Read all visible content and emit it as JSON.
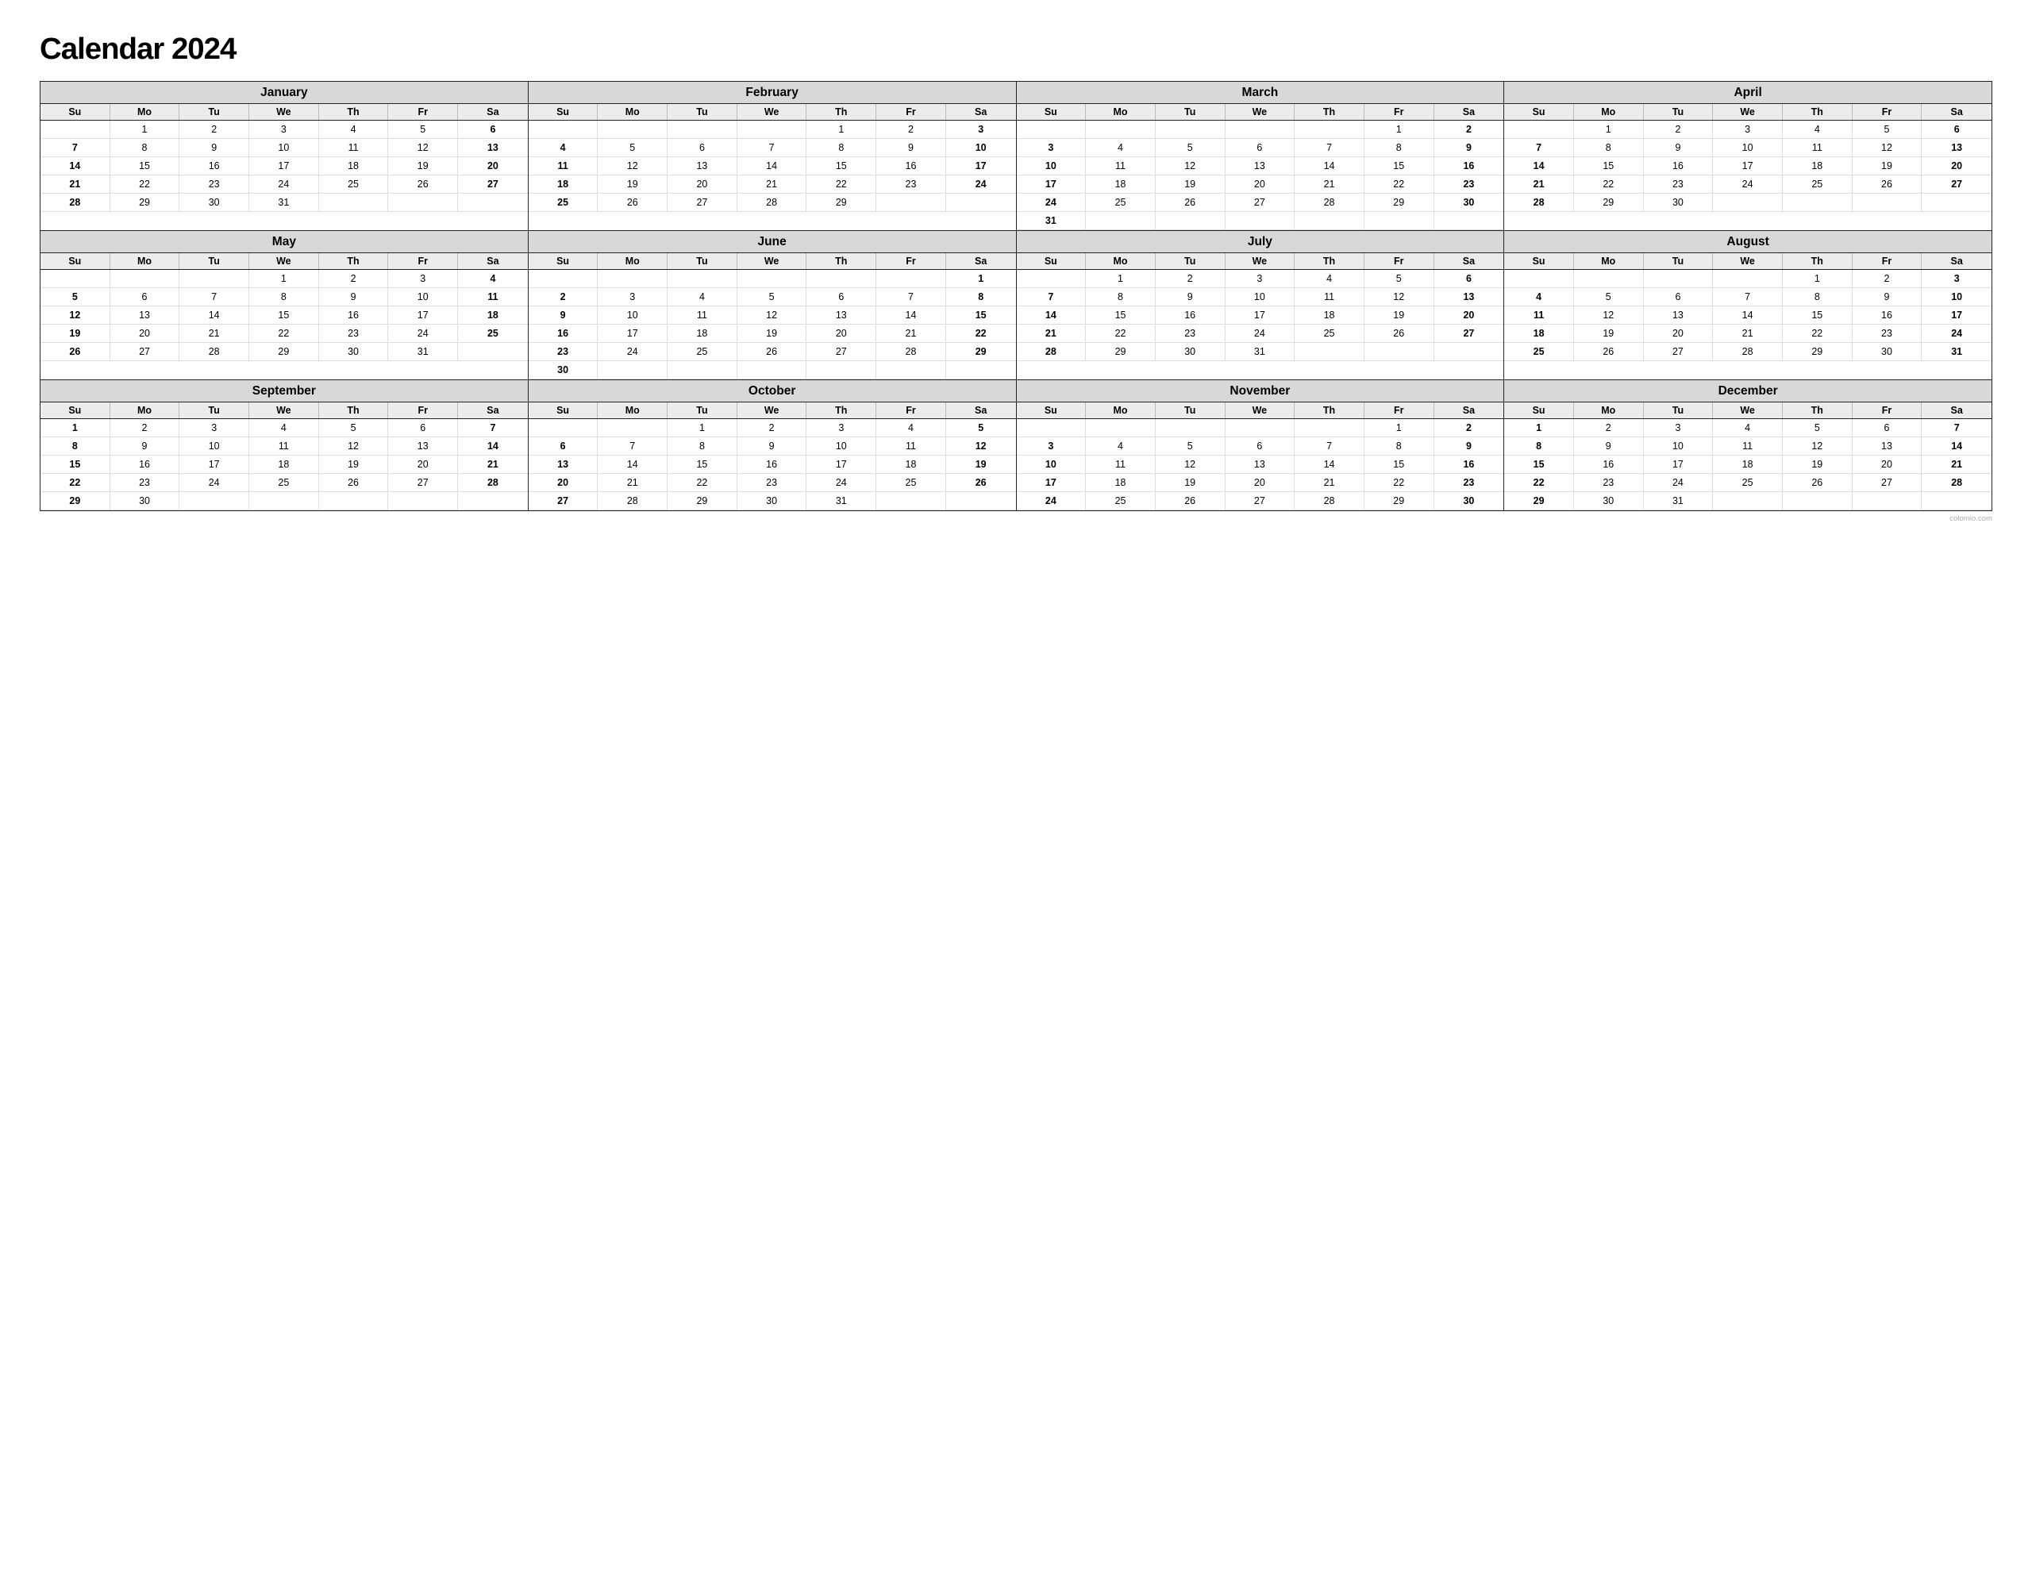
{
  "title": "Calendar 2024",
  "months": [
    {
      "name": "January",
      "startDay": 1,
      "days": 31,
      "weeks": [
        [
          "",
          "1",
          "2",
          "3",
          "4",
          "5",
          "6"
        ],
        [
          "7",
          "8",
          "9",
          "10",
          "11",
          "12",
          "13"
        ],
        [
          "14",
          "15",
          "16",
          "17",
          "18",
          "19",
          "20"
        ],
        [
          "21",
          "22",
          "23",
          "24",
          "25",
          "26",
          "27"
        ],
        [
          "28",
          "29",
          "30",
          "31",
          "",
          "",
          ""
        ]
      ]
    },
    {
      "name": "February",
      "startDay": 4,
      "days": 29,
      "weeks": [
        [
          "",
          "",
          "",
          "",
          "1",
          "2",
          "3"
        ],
        [
          "4",
          "5",
          "6",
          "7",
          "8",
          "9",
          "10"
        ],
        [
          "11",
          "12",
          "13",
          "14",
          "15",
          "16",
          "17"
        ],
        [
          "18",
          "19",
          "20",
          "21",
          "22",
          "23",
          "24"
        ],
        [
          "25",
          "26",
          "27",
          "28",
          "29",
          "",
          ""
        ]
      ]
    },
    {
      "name": "March",
      "startDay": 5,
      "days": 31,
      "weeks": [
        [
          "",
          "",
          "",
          "",
          "",
          "1",
          "2"
        ],
        [
          "3",
          "4",
          "5",
          "6",
          "7",
          "8",
          "9"
        ],
        [
          "10",
          "11",
          "12",
          "13",
          "14",
          "15",
          "16"
        ],
        [
          "17",
          "18",
          "19",
          "20",
          "21",
          "22",
          "23"
        ],
        [
          "24",
          "25",
          "26",
          "27",
          "28",
          "29",
          "30"
        ],
        [
          "31",
          "",
          "",
          "",
          "",
          "",
          ""
        ]
      ]
    },
    {
      "name": "April",
      "startDay": 1,
      "days": 30,
      "weeks": [
        [
          "",
          "1",
          "2",
          "3",
          "4",
          "5",
          "6"
        ],
        [
          "7",
          "8",
          "9",
          "10",
          "11",
          "12",
          "13"
        ],
        [
          "14",
          "15",
          "16",
          "17",
          "18",
          "19",
          "20"
        ],
        [
          "21",
          "22",
          "23",
          "24",
          "25",
          "26",
          "27"
        ],
        [
          "28",
          "29",
          "30",
          "",
          "",
          "",
          ""
        ]
      ]
    },
    {
      "name": "May",
      "startDay": 3,
      "days": 31,
      "weeks": [
        [
          "",
          "",
          "",
          "1",
          "2",
          "3",
          "4"
        ],
        [
          "5",
          "6",
          "7",
          "8",
          "9",
          "10",
          "11"
        ],
        [
          "12",
          "13",
          "14",
          "15",
          "16",
          "17",
          "18"
        ],
        [
          "19",
          "20",
          "21",
          "22",
          "23",
          "24",
          "25"
        ],
        [
          "26",
          "27",
          "28",
          "29",
          "30",
          "31",
          ""
        ]
      ]
    },
    {
      "name": "June",
      "startDay": 6,
      "days": 30,
      "weeks": [
        [
          "",
          "",
          "",
          "",
          "",
          "",
          "1"
        ],
        [
          "2",
          "3",
          "4",
          "5",
          "6",
          "7",
          "8"
        ],
        [
          "9",
          "10",
          "11",
          "12",
          "13",
          "14",
          "15"
        ],
        [
          "16",
          "17",
          "18",
          "19",
          "20",
          "21",
          "22"
        ],
        [
          "23",
          "24",
          "25",
          "26",
          "27",
          "28",
          "29"
        ],
        [
          "30",
          "",
          "",
          "",
          "",
          "",
          ""
        ]
      ]
    },
    {
      "name": "July",
      "startDay": 1,
      "days": 31,
      "weeks": [
        [
          "",
          "1",
          "2",
          "3",
          "4",
          "5",
          "6"
        ],
        [
          "7",
          "8",
          "9",
          "10",
          "11",
          "12",
          "13"
        ],
        [
          "14",
          "15",
          "16",
          "17",
          "18",
          "19",
          "20"
        ],
        [
          "21",
          "22",
          "23",
          "24",
          "25",
          "26",
          "27"
        ],
        [
          "28",
          "29",
          "30",
          "31",
          "",
          "",
          ""
        ]
      ]
    },
    {
      "name": "August",
      "startDay": 4,
      "days": 31,
      "weeks": [
        [
          "",
          "",
          "",
          "",
          "1",
          "2",
          "3"
        ],
        [
          "4",
          "5",
          "6",
          "7",
          "8",
          "9",
          "10"
        ],
        [
          "11",
          "12",
          "13",
          "14",
          "15",
          "16",
          "17"
        ],
        [
          "18",
          "19",
          "20",
          "21",
          "22",
          "23",
          "24"
        ],
        [
          "25",
          "26",
          "27",
          "28",
          "29",
          "30",
          "31"
        ]
      ]
    },
    {
      "name": "September",
      "startDay": 0,
      "days": 30,
      "weeks": [
        [
          "1",
          "2",
          "3",
          "4",
          "5",
          "6",
          "7"
        ],
        [
          "8",
          "9",
          "10",
          "11",
          "12",
          "13",
          "14"
        ],
        [
          "15",
          "16",
          "17",
          "18",
          "19",
          "20",
          "21"
        ],
        [
          "22",
          "23",
          "24",
          "25",
          "26",
          "27",
          "28"
        ],
        [
          "29",
          "30",
          "",
          "",
          "",
          "",
          ""
        ]
      ]
    },
    {
      "name": "October",
      "startDay": 2,
      "days": 31,
      "weeks": [
        [
          "",
          "",
          "1",
          "2",
          "3",
          "4",
          "5"
        ],
        [
          "6",
          "7",
          "8",
          "9",
          "10",
          "11",
          "12"
        ],
        [
          "13",
          "14",
          "15",
          "16",
          "17",
          "18",
          "19"
        ],
        [
          "20",
          "21",
          "22",
          "23",
          "24",
          "25",
          "26"
        ],
        [
          "27",
          "28",
          "29",
          "30",
          "31",
          "",
          ""
        ]
      ]
    },
    {
      "name": "November",
      "startDay": 5,
      "days": 30,
      "weeks": [
        [
          "",
          "",
          "",
          "",
          "",
          "1",
          "2"
        ],
        [
          "3",
          "4",
          "5",
          "6",
          "7",
          "8",
          "9"
        ],
        [
          "10",
          "11",
          "12",
          "13",
          "14",
          "15",
          "16"
        ],
        [
          "17",
          "18",
          "19",
          "20",
          "21",
          "22",
          "23"
        ],
        [
          "24",
          "25",
          "26",
          "27",
          "28",
          "29",
          "30"
        ]
      ]
    },
    {
      "name": "December",
      "startDay": 0,
      "days": 31,
      "weeks": [
        [
          "1",
          "2",
          "3",
          "4",
          "5",
          "6",
          "7"
        ],
        [
          "8",
          "9",
          "10",
          "11",
          "12",
          "13",
          "14"
        ],
        [
          "15",
          "16",
          "17",
          "18",
          "19",
          "20",
          "21"
        ],
        [
          "22",
          "23",
          "24",
          "25",
          "26",
          "27",
          "28"
        ],
        [
          "29",
          "30",
          "31",
          "",
          "",
          "",
          ""
        ]
      ]
    }
  ],
  "dayHeaders": [
    "Su",
    "Mo",
    "Tu",
    "We",
    "Th",
    "Fr",
    "Sa"
  ],
  "watermark": "colomio.com"
}
